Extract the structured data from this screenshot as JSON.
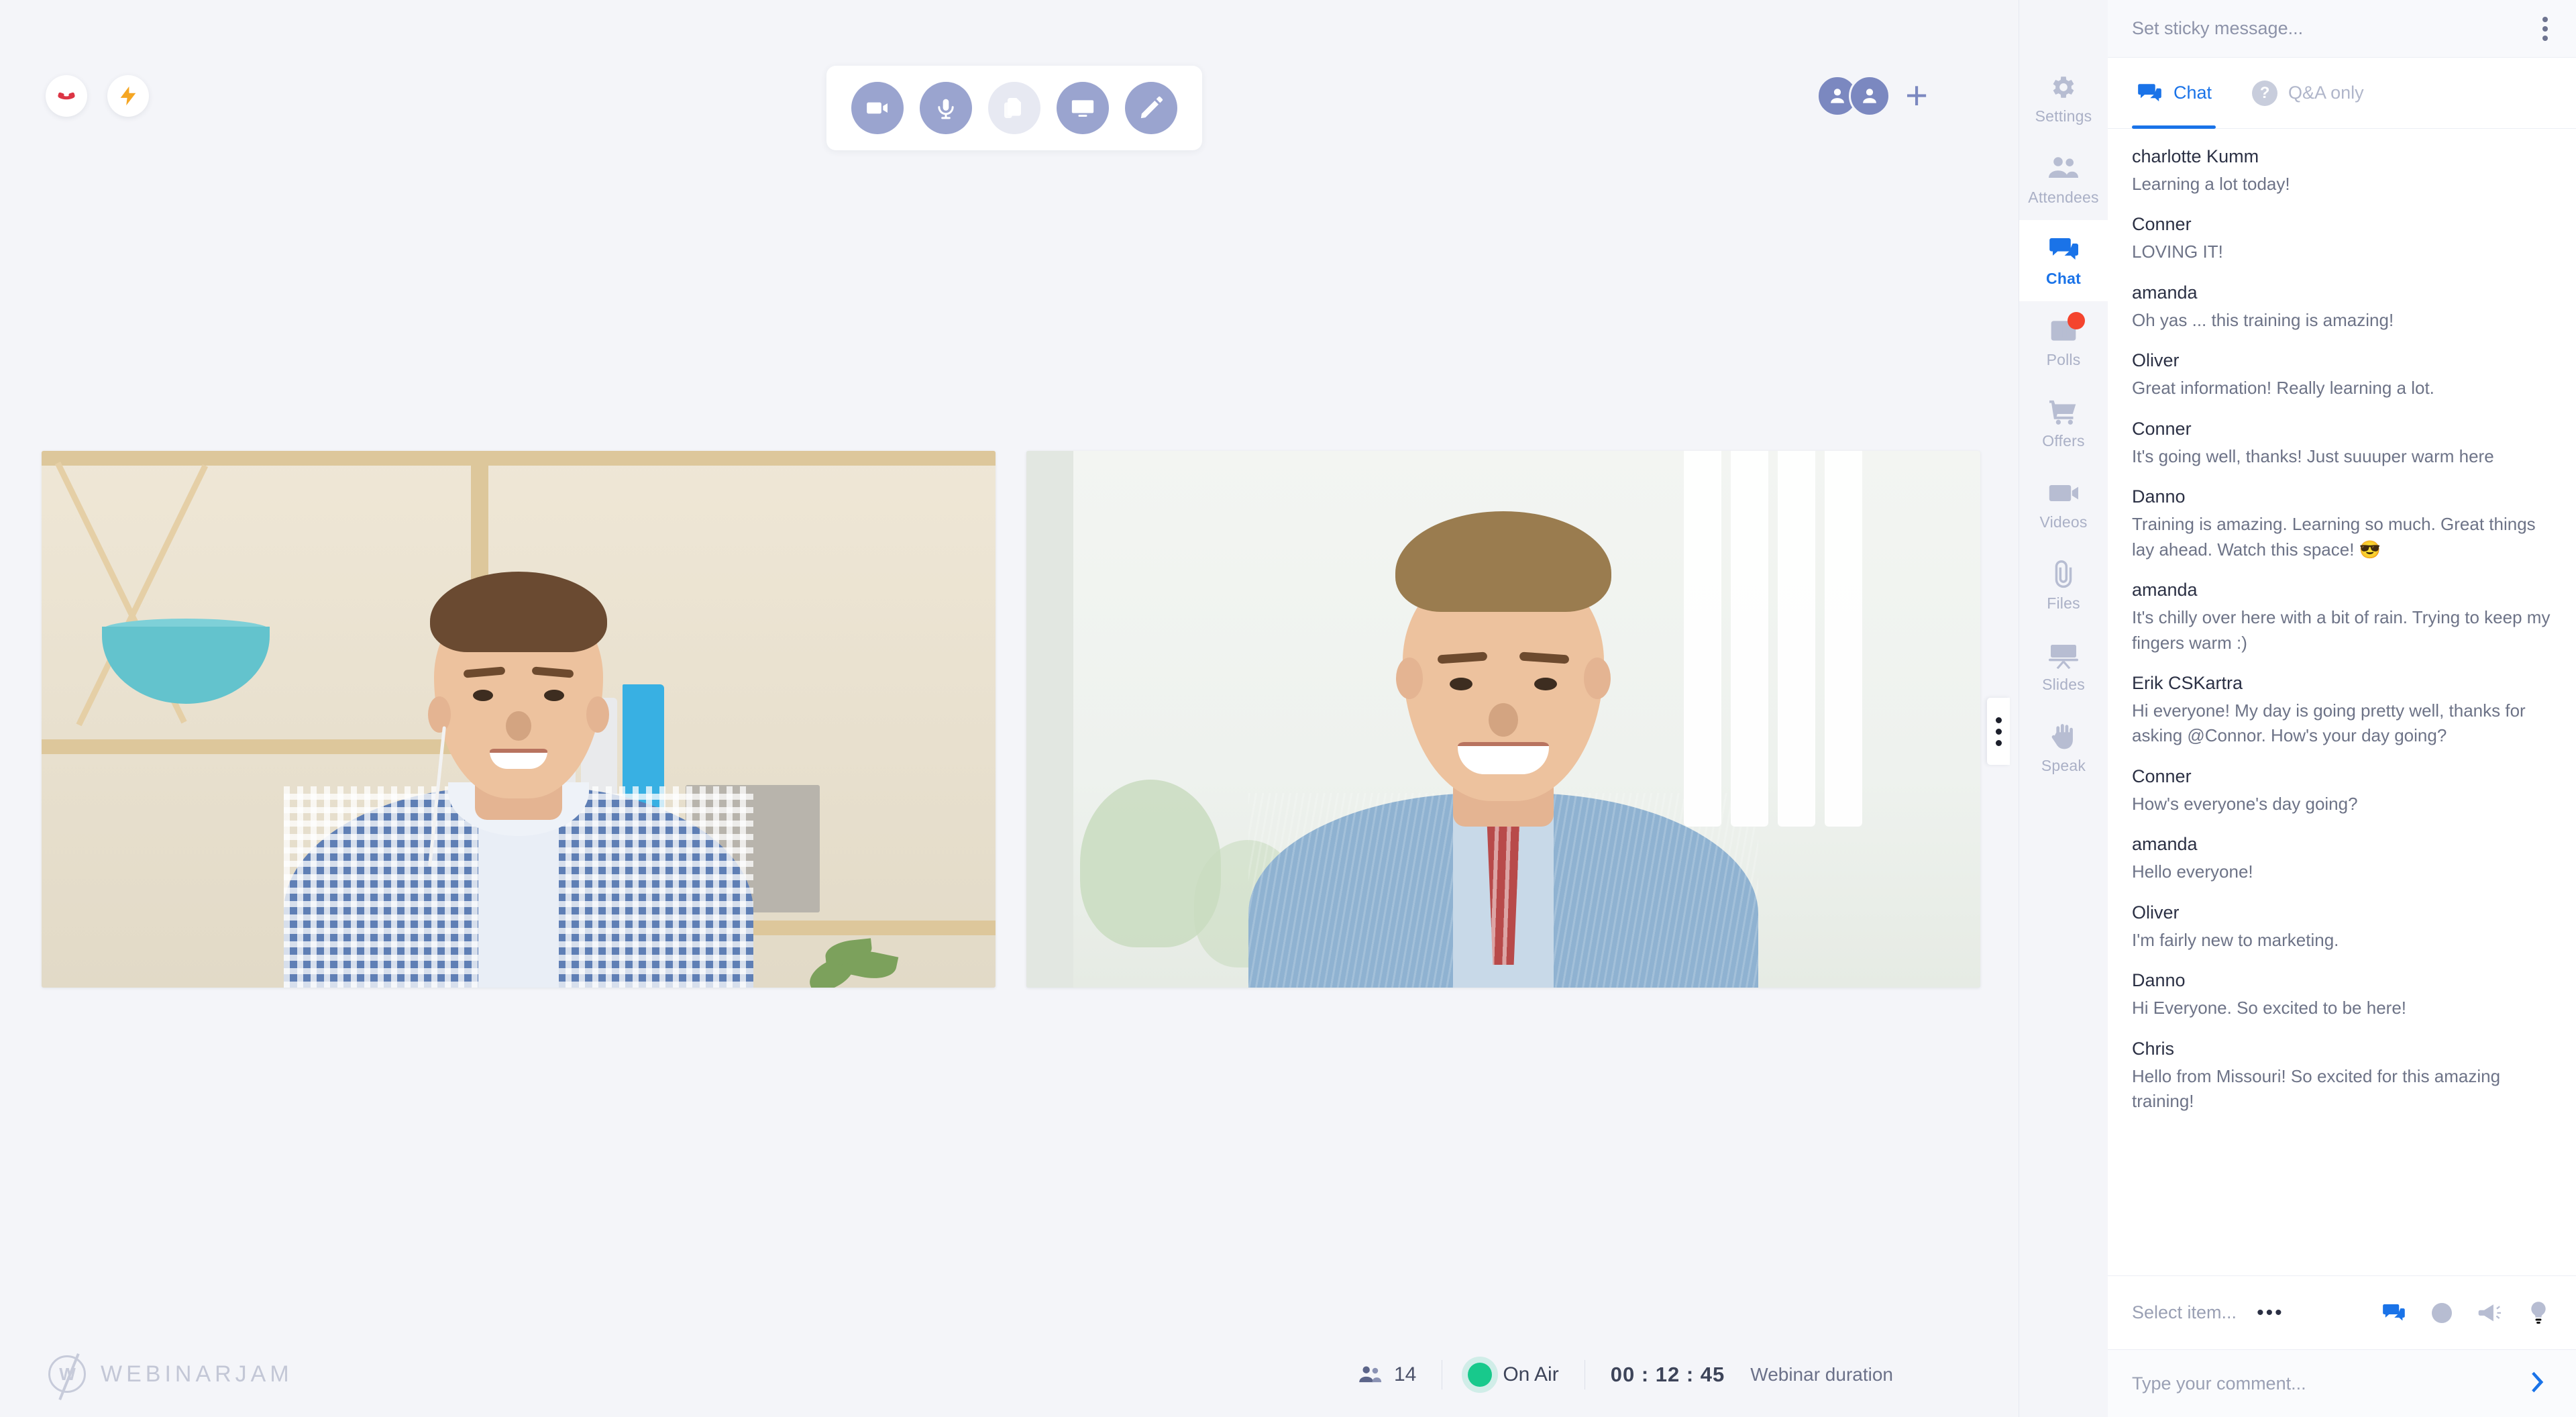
{
  "stage": {
    "left_controls": [
      {
        "name": "hang-up",
        "label": "Hang up"
      },
      {
        "name": "lightning",
        "label": "Quick actions"
      }
    ],
    "media_toolbar": [
      {
        "name": "camera",
        "label": "Camera",
        "state": "on"
      },
      {
        "name": "microphone",
        "label": "Microphone",
        "state": "on"
      },
      {
        "name": "share-file",
        "label": "Share file",
        "state": "off"
      },
      {
        "name": "share-screen",
        "label": "Share screen",
        "state": "on"
      },
      {
        "name": "whiteboard",
        "label": "Whiteboard",
        "state": "on"
      }
    ],
    "presenters": {
      "count": 2,
      "add_label": "+"
    },
    "collapse_handle_label": "Collapse panel"
  },
  "bottom_bar": {
    "logo_mark": "W",
    "logo_text": "WEBINARJAM",
    "attendees_count": "14",
    "status_label": "On Air",
    "status_color": "#18c98c",
    "timer": "00 : 12 : 45",
    "timer_label": "Webinar duration"
  },
  "rail": {
    "items": [
      {
        "label": "Settings",
        "icon": "gear-icon",
        "active": false,
        "badge": false
      },
      {
        "label": "Attendees",
        "icon": "people-icon",
        "active": false,
        "badge": false
      },
      {
        "label": "Chat",
        "icon": "chat-icon",
        "active": true,
        "badge": false
      },
      {
        "label": "Polls",
        "icon": "poll-icon",
        "active": false,
        "badge": true
      },
      {
        "label": "Offers",
        "icon": "cart-icon",
        "active": false,
        "badge": false
      },
      {
        "label": "Videos",
        "icon": "video-icon",
        "active": false,
        "badge": false
      },
      {
        "label": "Files",
        "icon": "paperclip-icon",
        "active": false,
        "badge": false
      },
      {
        "label": "Slides",
        "icon": "slides-icon",
        "active": false,
        "badge": false
      },
      {
        "label": "Speak",
        "icon": "hand-icon",
        "active": false,
        "badge": false
      }
    ]
  },
  "panel": {
    "sticky_placeholder": "Set sticky message...",
    "tabs": [
      {
        "label": "Chat",
        "icon": "chat-icon",
        "active": true
      },
      {
        "label": "Q&A only",
        "icon": "question-icon",
        "active": false
      }
    ],
    "messages": [
      {
        "author": "charlotte Kumm",
        "text": "Learning a lot today!"
      },
      {
        "author": "Conner",
        "text": "LOVING IT!"
      },
      {
        "author": "amanda",
        "text": "Oh yas ... this training is amazing!"
      },
      {
        "author": "Oliver",
        "text": "Great information! Really learning a lot."
      },
      {
        "author": "Conner",
        "text": "It's going well, thanks! Just suuuper warm here"
      },
      {
        "author": "Danno",
        "text": "Training is amazing. Learning so much. Great things lay ahead. Watch this space! 😎"
      },
      {
        "author": "amanda",
        "text": "It's chilly over here with a bit of rain. Trying to keep my fingers warm :)"
      },
      {
        "author": "Erik CSKartra",
        "text": "Hi everyone! My day is going pretty well, thanks for asking @Connor. How's your day going?"
      },
      {
        "author": "Conner",
        "text": "How's everyone's day going?"
      },
      {
        "author": "amanda",
        "text": "Hello everyone!"
      },
      {
        "author": "Oliver",
        "text": "I'm fairly new to marketing."
      },
      {
        "author": "Danno",
        "text": "Hi Everyone. So excited to be here!"
      },
      {
        "author": "Chris",
        "text": "Hello from Missouri! So excited for this amazing training!"
      }
    ],
    "composer": {
      "select_placeholder": "Select item...",
      "ellipsis": "•••",
      "icons": [
        {
          "name": "chat-icon",
          "label": "Chat",
          "active": true
        },
        {
          "name": "question-icon",
          "label": "Q&A",
          "active": false
        },
        {
          "name": "megaphone-icon",
          "label": "Announcement",
          "active": false
        },
        {
          "name": "lightbulb-icon",
          "label": "Highlight",
          "active": false
        }
      ],
      "comment_placeholder": "Type your comment...",
      "send_label": "Send"
    }
  },
  "colors": {
    "accent": "#1a73e8",
    "muted_icon": "#b7bdd2",
    "page_bg": "#eceef4",
    "stage_bg": "#f4f5f9",
    "badge_red": "#f4442e",
    "on_air_green": "#18c98c"
  }
}
